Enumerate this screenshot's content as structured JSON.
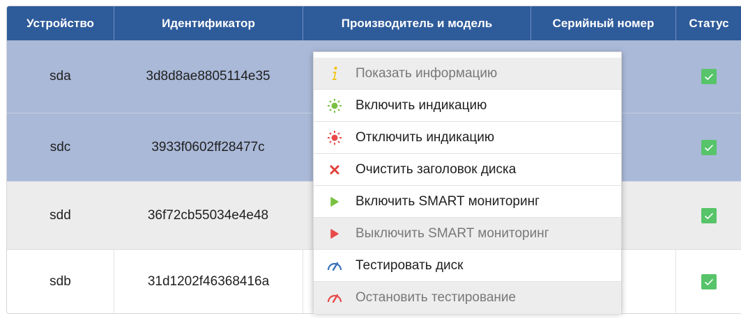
{
  "table": {
    "columns": [
      "Устройство",
      "Идентификатор",
      "Производитель и модель",
      "Серийный номер",
      "Статус"
    ],
    "rows": [
      {
        "device": "sda",
        "id": "3d8d8ae8805114e35",
        "status": "ok",
        "state": "selected"
      },
      {
        "device": "sdc",
        "id": "3933f0602ff28477c",
        "status": "ok",
        "state": "selected"
      },
      {
        "device": "sdd",
        "id": "36f72cb55034e4e48",
        "status": "ok",
        "state": "normal"
      },
      {
        "device": "sdb",
        "id": "31d1202f46368416a",
        "status": "ok",
        "state": "normal"
      }
    ]
  },
  "context_menu": {
    "items": [
      {
        "label": "Показать информацию",
        "icon": "info-icon",
        "disabled": true
      },
      {
        "label": "Включить индикацию",
        "icon": "indicator-on-icon",
        "disabled": false
      },
      {
        "label": "Отключить индикацию",
        "icon": "indicator-off-icon",
        "disabled": false
      },
      {
        "label": "Очистить заголовок диска",
        "icon": "clear-header-icon",
        "disabled": false
      },
      {
        "label": "Включить SMART мониторинг",
        "icon": "smart-on-icon",
        "disabled": false
      },
      {
        "label": "Выключить SMART мониторинг",
        "icon": "smart-off-icon",
        "disabled": true
      },
      {
        "label": "Тестировать диск",
        "icon": "test-disk-icon",
        "disabled": false
      },
      {
        "label": "Остановить тестирование",
        "icon": "stop-test-icon",
        "disabled": true
      }
    ]
  },
  "colors": {
    "header_bg": "#2e5b9a",
    "selected_row_bg": "#aab9d8",
    "status_ok": "#57c46a",
    "info_icon": "#f2c418",
    "green_icon": "#7ac143",
    "red_icon": "#e84a4a",
    "blue_icon": "#3a72b8"
  }
}
